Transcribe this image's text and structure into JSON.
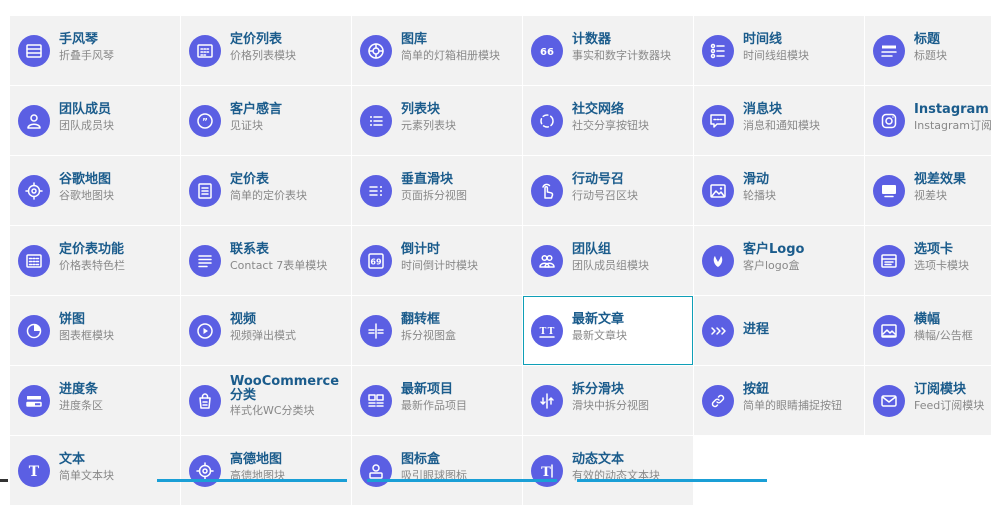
{
  "accent_color": "#5b5fe3",
  "title_color": "#1b5c8c",
  "rows": [
    [
      {
        "title": "手风琴",
        "sub": "折叠手风琴",
        "icon": "accordion-icon"
      },
      {
        "title": "定价列表",
        "sub": "价格列表模块",
        "icon": "price-list-icon"
      },
      {
        "title": "图库",
        "sub": "简单的灯箱相册模块",
        "icon": "gallery-icon"
      },
      {
        "title": "计数器",
        "sub": "事实和数字计数器块",
        "icon": "counter-icon"
      },
      {
        "title": "时间线",
        "sub": "时间线组模块",
        "icon": "timeline-icon"
      },
      {
        "title": "标题",
        "sub": "标题块",
        "icon": "heading-icon"
      }
    ],
    [
      {
        "title": "团队成员",
        "sub": "团队成员块",
        "icon": "team-member-icon"
      },
      {
        "title": "客户感言",
        "sub": "见证块",
        "icon": "testimonial-icon"
      },
      {
        "title": "列表块",
        "sub": "元素列表块",
        "icon": "list-icon"
      },
      {
        "title": "社交网络",
        "sub": "社交分享按钮块",
        "icon": "social-icon"
      },
      {
        "title": "消息块",
        "sub": "消息和通知模块",
        "icon": "message-icon"
      },
      {
        "title": "Instagram 订",
        "sub": "Instagram订阅",
        "icon": "instagram-icon"
      }
    ],
    [
      {
        "title": "谷歌地图",
        "sub": "谷歌地图块",
        "icon": "map-target-icon"
      },
      {
        "title": "定价表",
        "sub": "简单的定价表块",
        "icon": "pricing-table-icon"
      },
      {
        "title": "垂直滑块",
        "sub": "页面拆分视图",
        "icon": "vertical-slider-icon"
      },
      {
        "title": "行动号召",
        "sub": "行动号召区块",
        "icon": "call-to-action-icon"
      },
      {
        "title": "滑动",
        "sub": "轮播块",
        "icon": "slider-image-icon"
      },
      {
        "title": "视差效果",
        "sub": "视差块",
        "icon": "parallax-icon"
      }
    ],
    [
      {
        "title": "定价表功能",
        "sub": "价格表特色栏",
        "icon": "pricing-features-icon"
      },
      {
        "title": "联系表",
        "sub": "Contact 7表单模块",
        "icon": "contact-form-icon"
      },
      {
        "title": "倒计时",
        "sub": "时间倒计时模块",
        "icon": "countdown-icon"
      },
      {
        "title": "团队组",
        "sub": "团队成员组模块",
        "icon": "team-group-icon"
      },
      {
        "title": "客户Logo",
        "sub": "客户logo盒",
        "icon": "client-logo-icon"
      },
      {
        "title": "选项卡",
        "sub": "选项卡模块",
        "icon": "tabs-icon"
      }
    ],
    [
      {
        "title": "饼图",
        "sub": "图表框模块",
        "icon": "pie-chart-icon"
      },
      {
        "title": "视频",
        "sub": "视频弹出模式",
        "icon": "video-play-icon"
      },
      {
        "title": "翻转框",
        "sub": "拆分视图盒",
        "icon": "flip-box-icon"
      },
      {
        "title": "最新文章",
        "sub": "最新文章块",
        "icon": "latest-posts-icon",
        "selected": true
      },
      {
        "title": "进程",
        "sub": "",
        "icon": "process-icon"
      },
      {
        "title": "横幅",
        "sub": "横幅/公告框",
        "icon": "banner-icon"
      }
    ],
    [
      {
        "title": "进度条",
        "sub": "进度条区",
        "icon": "progress-bar-icon"
      },
      {
        "title": "WooCommerce 分类",
        "sub": "样式化WC分类块",
        "icon": "woocommerce-icon",
        "wrap": true
      },
      {
        "title": "最新项目",
        "sub": "最新作品项目",
        "icon": "latest-projects-icon"
      },
      {
        "title": "拆分滑块",
        "sub": "滑块中拆分视图",
        "icon": "split-slider-icon"
      },
      {
        "title": "按鈕",
        "sub": "简单的眼睛捕捉按钮",
        "icon": "button-link-icon"
      },
      {
        "title": "订阅模块",
        "sub": "Feed订阅模块",
        "icon": "subscribe-mail-icon"
      }
    ],
    [
      {
        "title": "文本",
        "sub": "简单文本块",
        "icon": "text-icon"
      },
      {
        "title": "高德地图",
        "sub": "高德地图块",
        "icon": "amap-icon"
      },
      {
        "title": "图标盒",
        "sub": "吸引眼球图标",
        "icon": "icon-box-icon"
      },
      {
        "title": "动态文本",
        "sub": "有效的动态文本块",
        "icon": "dynamic-text-icon"
      },
      {
        "empty": true
      },
      {
        "empty": true
      }
    ]
  ]
}
